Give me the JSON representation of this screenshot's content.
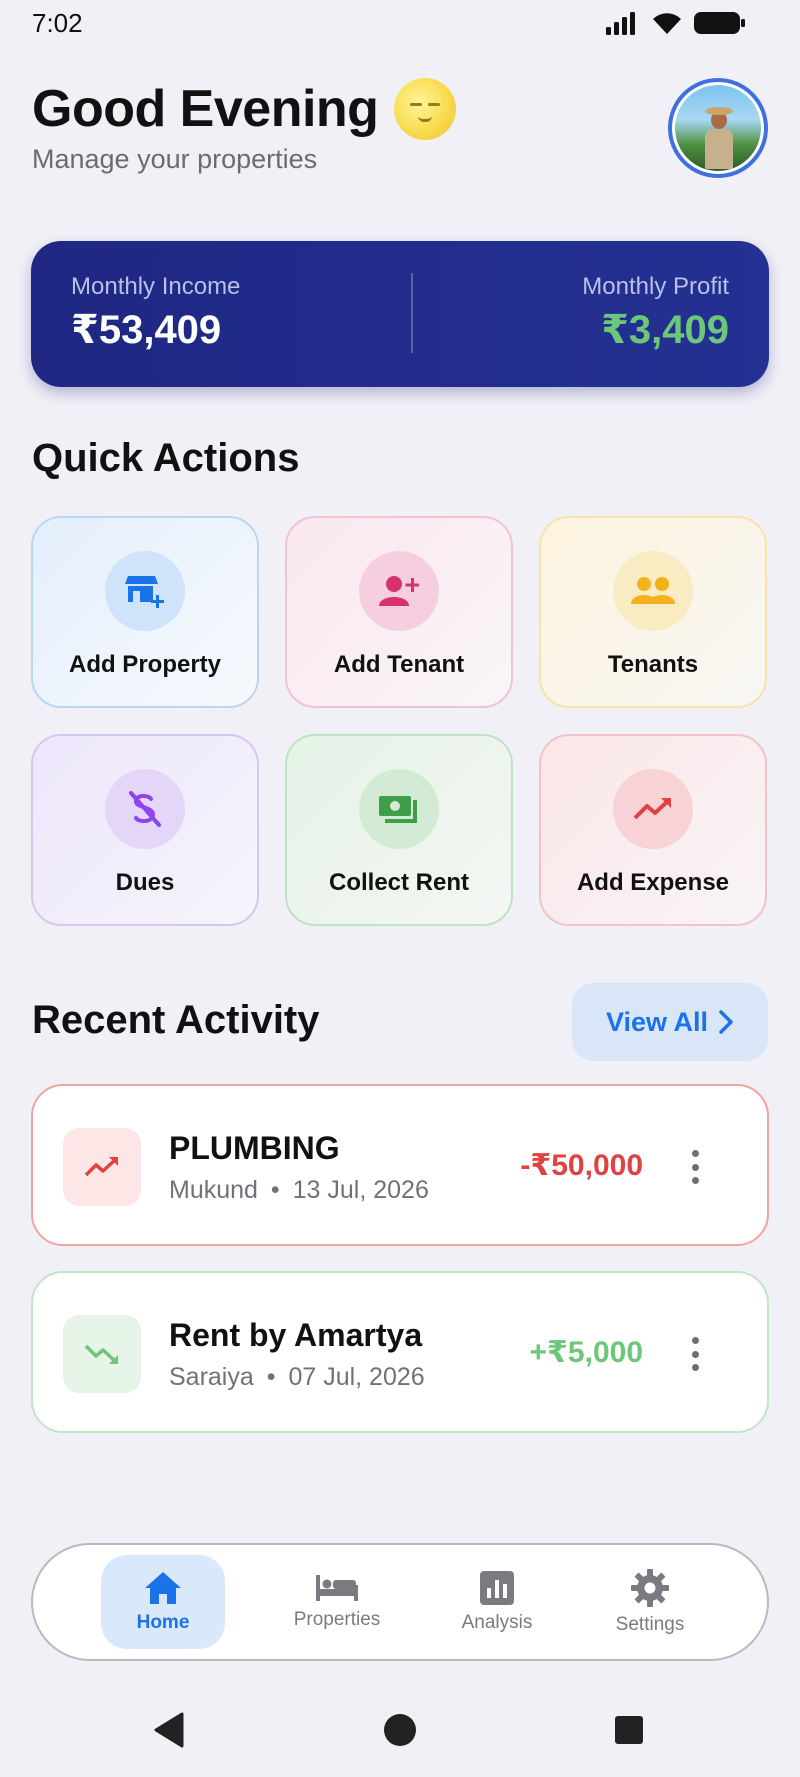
{
  "status_bar": {
    "time": "7:02"
  },
  "header": {
    "greeting": "Good Evening",
    "subtitle": "Manage your properties"
  },
  "summary": {
    "income_label": "Monthly Income",
    "income_value": "₹53,409",
    "profit_label": "Monthly Profit",
    "profit_value": "₹3,409"
  },
  "quick_actions": {
    "title": "Quick Actions",
    "items": [
      {
        "label": "Add Property",
        "icon": "add-property-icon",
        "color": "#1a73e8"
      },
      {
        "label": "Add Tenant",
        "icon": "add-tenant-icon",
        "color": "#d6336c"
      },
      {
        "label": "Tenants",
        "icon": "tenants-icon",
        "color": "#f2b21c"
      },
      {
        "label": "Dues",
        "icon": "dues-icon",
        "color": "#8e44ec"
      },
      {
        "label": "Collect Rent",
        "icon": "collect-rent-icon",
        "color": "#3e9e4a"
      },
      {
        "label": "Add Expense",
        "icon": "add-expense-icon",
        "color": "#e04141"
      }
    ]
  },
  "recent_activity": {
    "title": "Recent Activity",
    "view_all": "View All",
    "items": [
      {
        "title": "PLUMBING",
        "person": "Mukund",
        "date": "13 Jul, 2026",
        "amount": "-₹50,000",
        "type": "expense",
        "color": "#e04141"
      },
      {
        "title": "Rent by Amartya",
        "person": "Saraiya",
        "date": "07 Jul, 2026",
        "amount": "+₹5,000",
        "type": "income",
        "color": "#6dc77a"
      }
    ]
  },
  "bottom_nav": {
    "items": [
      {
        "label": "Home",
        "icon": "home-icon",
        "active": true
      },
      {
        "label": "Properties",
        "icon": "bed-icon",
        "active": false
      },
      {
        "label": "Analysis",
        "icon": "analytics-icon",
        "active": false
      },
      {
        "label": "Settings",
        "icon": "gear-icon",
        "active": false
      }
    ]
  },
  "colors": {
    "accent": "#1a73e8",
    "card_dark": "#1f2783",
    "profit_green": "#6dc77a",
    "expense_red": "#e04141",
    "background": "#f1f0f7"
  }
}
